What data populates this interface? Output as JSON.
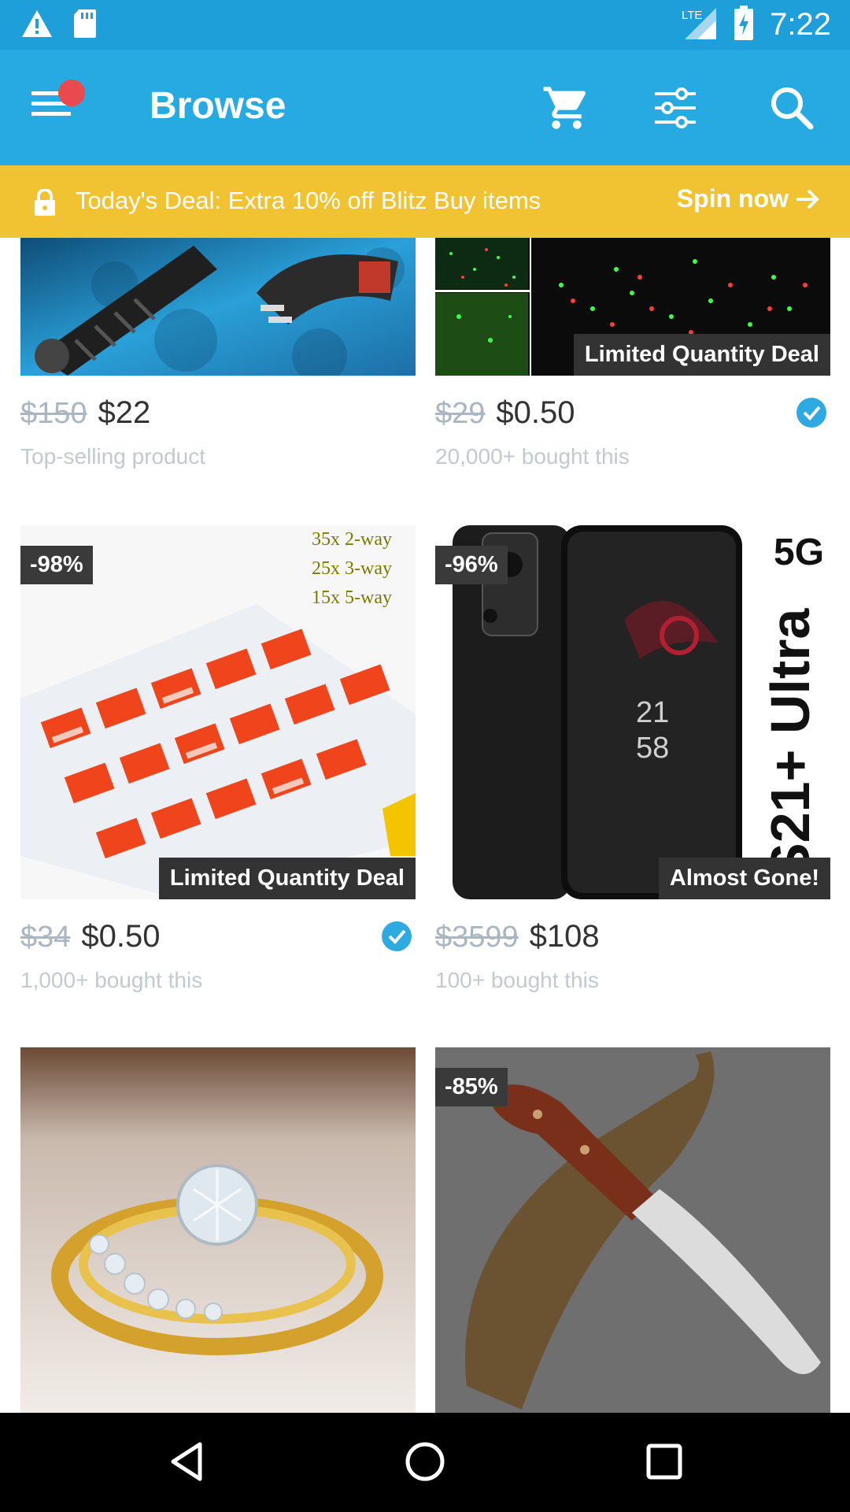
{
  "status_bar": {
    "time": "7:22",
    "network": "LTE",
    "icons": [
      "warning-icon",
      "sd-card-icon",
      "lte-signal-icon",
      "battery-charging-icon"
    ]
  },
  "app_bar": {
    "title": "Browse",
    "icons": [
      "menu-icon",
      "cart-icon",
      "filter-icon",
      "search-icon"
    ],
    "accent_color": "#26aae1"
  },
  "deal_banner": {
    "text": "Today's Deal: Extra 10% off Blitz Buy items",
    "action": "Spin now",
    "color": "#f1c232"
  },
  "products": [
    {
      "old_price": "$150",
      "price": "$22",
      "subtitle": "Top-selling product",
      "discount": "",
      "tag": "",
      "verified": false
    },
    {
      "old_price": "$29",
      "price": "$0.50",
      "subtitle": "20,000+ bought this",
      "discount": "",
      "tag": "Limited Quantity Deal",
      "verified": true
    },
    {
      "old_price": "$34",
      "price": "$0.50",
      "subtitle": "1,000+ bought this",
      "discount": "-98%",
      "tag": "Limited Quantity Deal",
      "verified": true,
      "image_text": [
        "35x 2-way",
        "25x 3-way",
        "15x 5-way"
      ]
    },
    {
      "old_price": "$3599",
      "price": "$108",
      "subtitle": "100+ bought this",
      "discount": "-96%",
      "tag": "Almost Gone!",
      "verified": false,
      "image_text": [
        "5G",
        "S21+ Ultra",
        "21",
        "58"
      ]
    },
    {
      "discount": ""
    },
    {
      "discount": "-85%"
    }
  ]
}
